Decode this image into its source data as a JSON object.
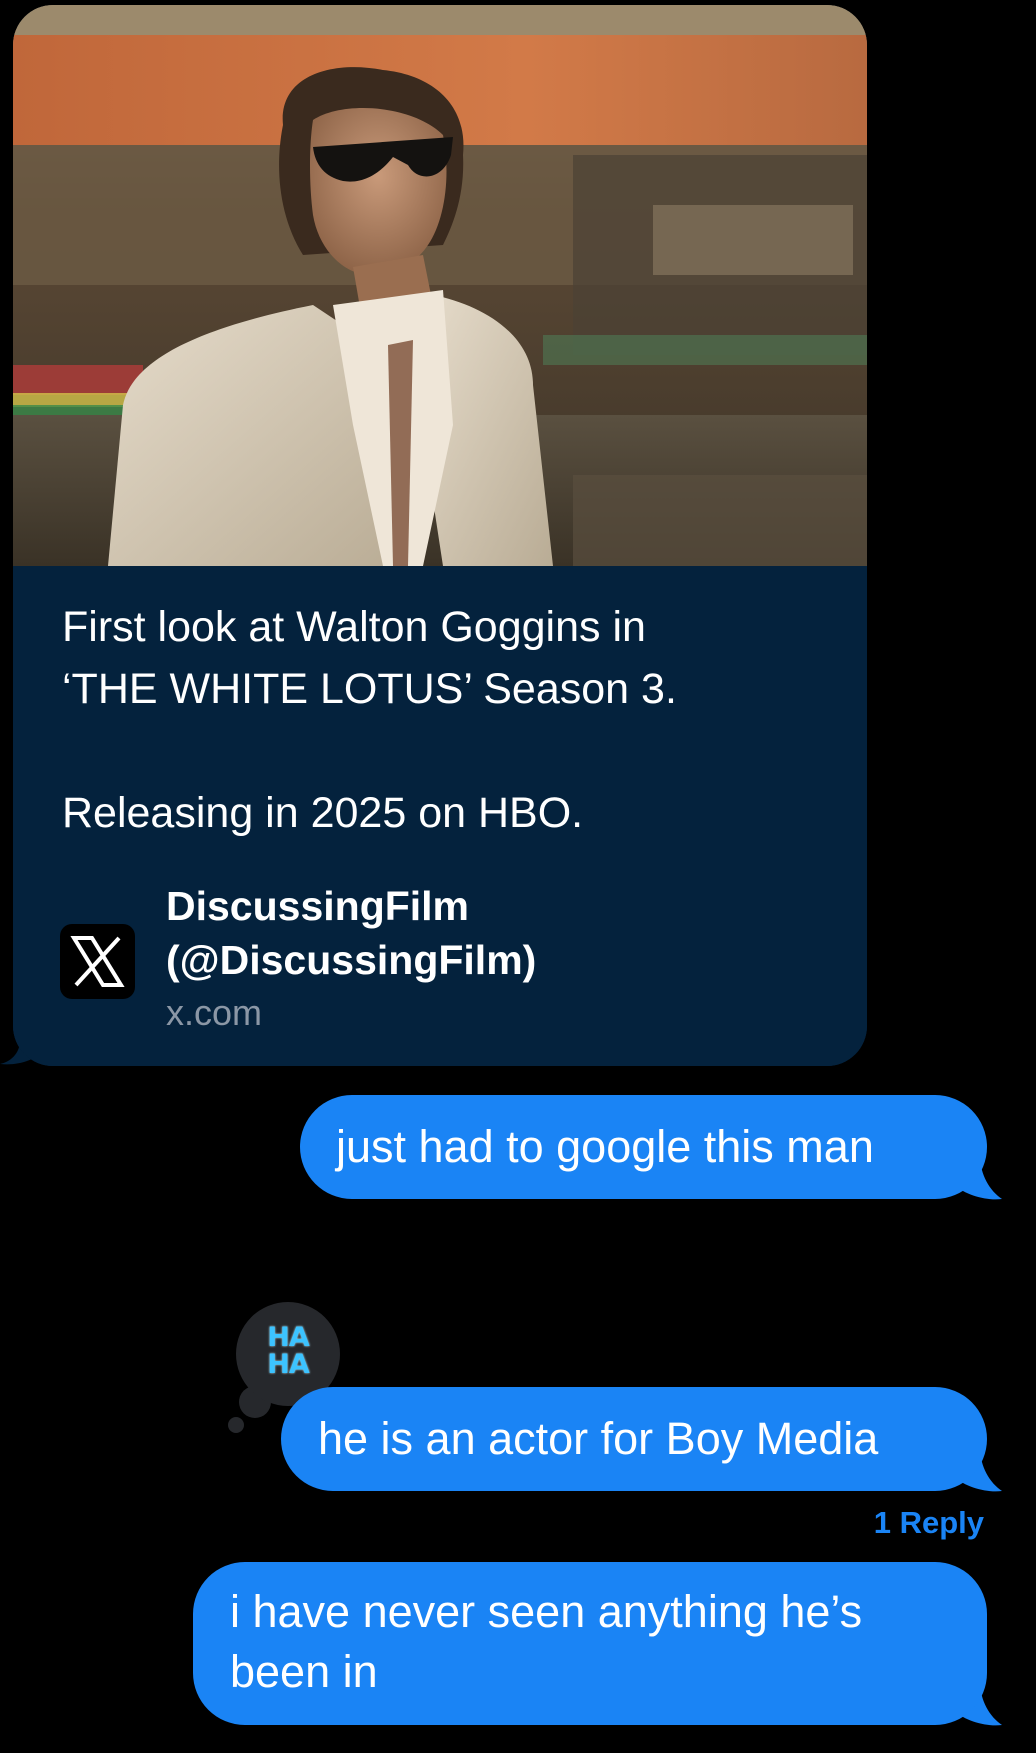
{
  "link_preview": {
    "icon": "x-logo-icon",
    "image_alt": "Photo of a man in sunglasses and a light linen jacket by a waterfront",
    "text_lines": [
      "First look at Walton Goggins in",
      "‘THE WHITE LOTUS’ Season 3.",
      "",
      "Releasing in 2025 on HBO."
    ],
    "source_name_line1": "DiscussingFilm",
    "source_name_line2": "(@DiscussingFilm)",
    "source_domain": "x.com"
  },
  "messages": [
    {
      "text": "just had to google this man"
    },
    {
      "text": "he is an actor for Boy Media",
      "tapback": {
        "icon": "haha-tapback-icon",
        "line1": "HA",
        "line2": "HA"
      }
    },
    {
      "text": "i have never seen anything he’s been in"
    }
  ],
  "reply_count_label": "1 Reply",
  "colors": {
    "background": "#000000",
    "sent_bubble": "#1a84f5",
    "preview_card": "#04223d",
    "tapback_bubble": "#26282c",
    "haha_text": "#3cc3ff"
  }
}
